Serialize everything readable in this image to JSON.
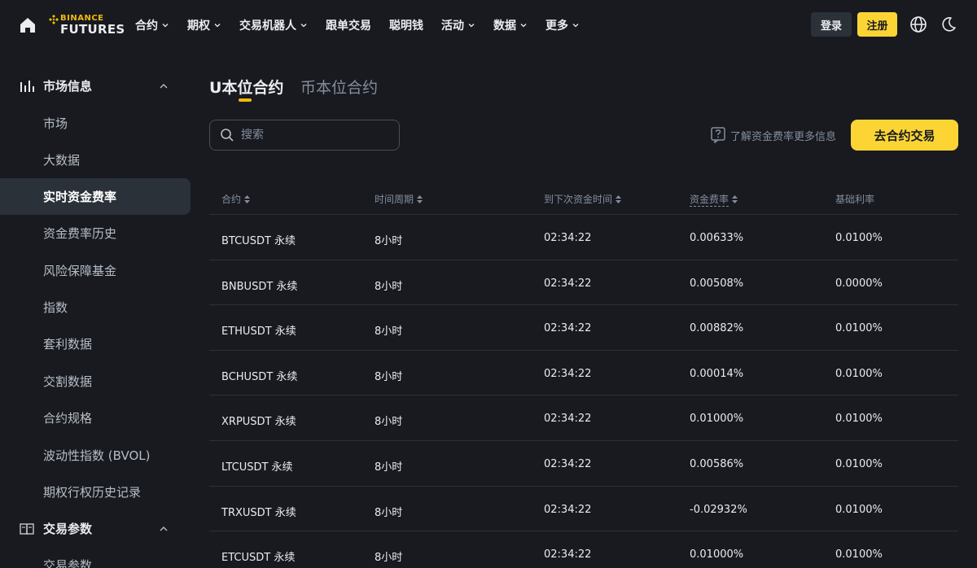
{
  "header": {
    "brand_top": "BINANCE",
    "brand_bottom": "FUTURES",
    "nav": [
      {
        "label": "合约",
        "has_dropdown": true
      },
      {
        "label": "期权",
        "has_dropdown": true
      },
      {
        "label": "交易机器人",
        "has_dropdown": true
      },
      {
        "label": "跟单交易",
        "has_dropdown": false
      },
      {
        "label": "聪明钱",
        "has_dropdown": false
      },
      {
        "label": "活动",
        "has_dropdown": true
      },
      {
        "label": "数据",
        "has_dropdown": true
      },
      {
        "label": "更多",
        "has_dropdown": true
      }
    ],
    "login_label": "登录",
    "register_label": "注册",
    "icons": [
      "home-icon",
      "globe-icon",
      "moon-icon"
    ]
  },
  "sidebar": {
    "group_market": {
      "label": "市场信息",
      "icon": "bar-chart-icon",
      "expanded": true
    },
    "items": [
      {
        "label": "市场",
        "active": false
      },
      {
        "label": "大数据",
        "active": false
      },
      {
        "label": "实时资金费率",
        "active": true
      },
      {
        "label": "资金费率历史",
        "active": false
      },
      {
        "label": "风险保障基金",
        "active": false
      },
      {
        "label": "指数",
        "active": false
      },
      {
        "label": "套利数据",
        "active": false
      },
      {
        "label": "交割数据",
        "active": false
      },
      {
        "label": "合约规格",
        "active": false
      },
      {
        "label": "波动性指数 (BVOL)",
        "active": false
      },
      {
        "label": "期权行权历史记录",
        "active": false
      }
    ],
    "group_params": {
      "label": "交易参数",
      "icon": "book-icon",
      "expanded": true
    },
    "params_items": [
      {
        "label": "交易参数"
      }
    ]
  },
  "main": {
    "tabs": [
      {
        "label": "U本位合约",
        "active": true
      },
      {
        "label": "币本位合约",
        "active": false
      }
    ],
    "search": {
      "placeholder": "搜索",
      "value": ""
    },
    "info_link": "了解资金费率更多信息",
    "trade_button": "去合约交易",
    "accent_color": "#fcd535",
    "table": {
      "columns": [
        "合约",
        "时间周期",
        "到下次资金时间",
        "资金费率",
        "基础利率"
      ],
      "rows": [
        [
          "BTCUSDT 永续",
          "8小时",
          "02:34:22",
          "0.00633%",
          "0.0100%"
        ],
        [
          "BNBUSDT 永续",
          "8小时",
          "02:34:22",
          "0.00508%",
          "0.0000%"
        ],
        [
          "ETHUSDT 永续",
          "8小时",
          "02:34:22",
          "0.00882%",
          "0.0100%"
        ],
        [
          "BCHUSDT 永续",
          "8小时",
          "02:34:22",
          "0.00014%",
          "0.0100%"
        ],
        [
          "XRPUSDT 永续",
          "8小时",
          "02:34:22",
          "0.01000%",
          "0.0100%"
        ],
        [
          "LTCUSDT 永续",
          "8小时",
          "02:34:22",
          "0.00586%",
          "0.0100%"
        ],
        [
          "TRXUSDT 永续",
          "8小时",
          "02:34:22",
          "-0.02932%",
          "0.0100%"
        ],
        [
          "ETCUSDT 永续",
          "8小时",
          "02:34:22",
          "0.01000%",
          "0.0100%"
        ]
      ]
    }
  }
}
